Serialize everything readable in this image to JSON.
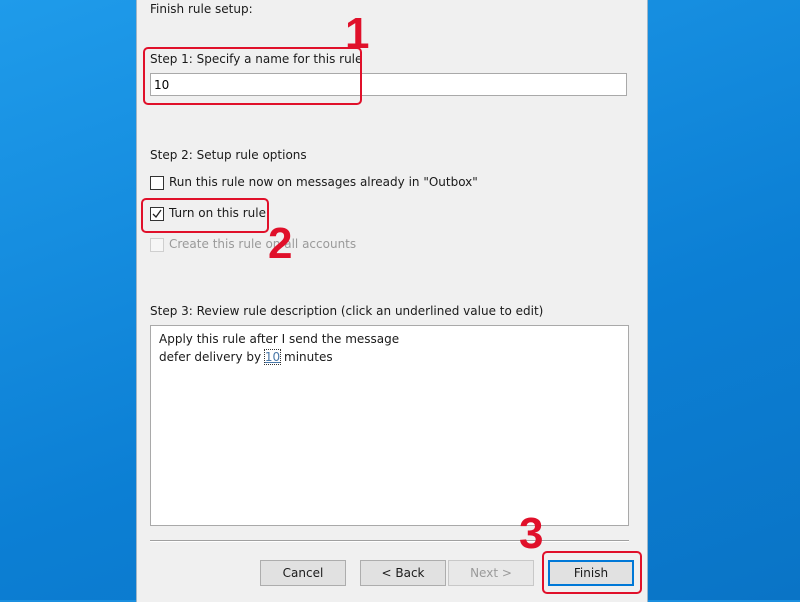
{
  "header": {
    "title": "Finish rule setup:"
  },
  "step1": {
    "label": "Step 1: Specify a name for this rule",
    "value": "10"
  },
  "step2": {
    "label": "Step 2: Setup rule options",
    "options": [
      {
        "label": "Run this rule now on messages already in \"Outbox\"",
        "checked": false,
        "enabled": true
      },
      {
        "label": "Turn on this rule",
        "checked": true,
        "enabled": true
      },
      {
        "label": "Create this rule on all accounts",
        "checked": false,
        "enabled": false
      }
    ]
  },
  "step3": {
    "label": "Step 3: Review rule description (click an underlined value to edit)",
    "line1": "Apply this rule after I send the message",
    "line2_pre": "defer delivery by",
    "line2_value": "10",
    "line2_post": "minutes"
  },
  "buttons": {
    "cancel": "Cancel",
    "back": "< Back",
    "next": "Next >",
    "finish": "Finish"
  },
  "annotations": {
    "one": "1",
    "two": "2",
    "three": "3",
    "color": "#e0102a"
  }
}
